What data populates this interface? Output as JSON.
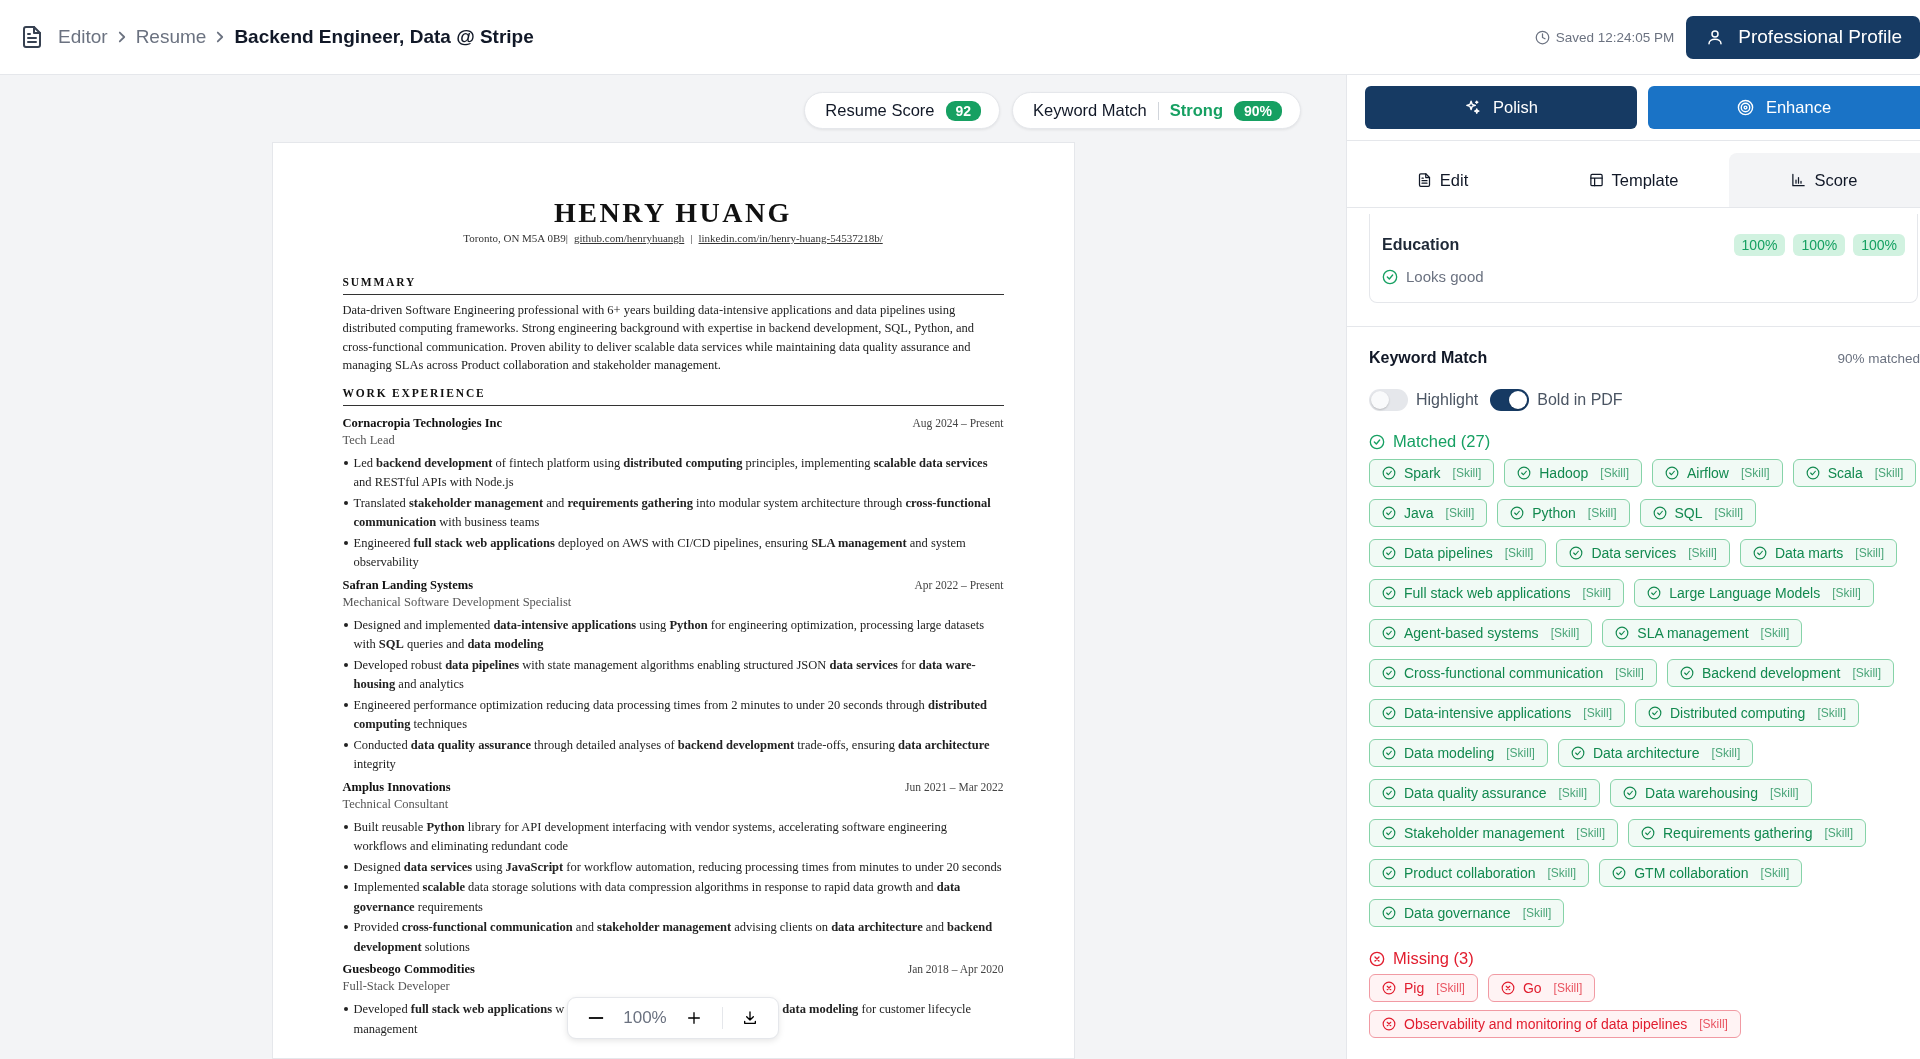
{
  "header": {
    "breadcrumb": [
      {
        "label": "Editor",
        "current": false
      },
      {
        "label": "Resume",
        "current": false
      },
      {
        "label": "Backend Engineer, Data @ Stripe",
        "current": true
      }
    ],
    "saved": "Saved 12:24:05 PM",
    "profile_button": "Professional Profile"
  },
  "scores": {
    "resume_score": {
      "label": "Resume Score",
      "value": "92"
    },
    "keyword_match": {
      "label": "Keyword Match",
      "rating": "Strong",
      "value": "90%"
    }
  },
  "resume": {
    "name": "HENRY HUANG",
    "contact": [
      {
        "kind": "text",
        "text": "Toronto, ON M5A 0B9|"
      },
      {
        "kind": "link",
        "text": "github.com/henryhuangh"
      },
      {
        "kind": "text",
        "text": "|"
      },
      {
        "kind": "link",
        "text": "linkedin.com/in/henry-huang-54537218b/"
      }
    ],
    "summary": {
      "heading": "SUMMARY",
      "text": "Data-driven Software Engineering professional with 6+ years building data-intensive applications and data pipelines using distributed computing frameworks. Strong engineering background with expertise in backend development, SQL, Python, and cross-functional communication. Proven ability to deliver scalable data services while maintaining data quality assurance and managing SLAs across Product collaboration and stakeholder management."
    },
    "experience": {
      "heading": "WORK EXPERIENCE",
      "jobs": [
        {
          "company": "Cornacropia Technologies Inc",
          "dates": "Aug 2024 – Present",
          "title": "Tech Lead",
          "bullets": [
            [
              "Led **backend development** of fintech platform using **distributed computing** principles, implementing **scalable data services** and RESTful APIs with Node.js"
            ],
            [
              "Translated **stakeholder management** and **requirements gathering** into modular system architecture through **cross-functional communication** with business teams"
            ],
            [
              "Engineered **full stack web applications** deployed on AWS with CI/CD pipelines, ensuring **SLA management** and system observability"
            ]
          ]
        },
        {
          "company": "Safran Landing Systems",
          "dates": "Apr 2022 – Present",
          "title": "Mechanical Software Development Specialist",
          "bullets": [
            [
              "Designed and implemented **data-intensive applications** using **Python** for engineering optimization, processing large datasets with **SQL** queries and **data modeling**"
            ],
            [
              "Developed robust **data pipelines** with state management algorithms enabling structured JSON **data services** for **data ware-housing** and analytics"
            ],
            [
              "Engineered performance optimization reducing data processing times from 2 minutes to under 20 seconds through **distributed computing** techniques"
            ],
            [
              "Conducted **data quality assurance** through detailed analyses of **backend development** trade-offs, ensuring **data architecture** integrity"
            ]
          ]
        },
        {
          "company": "Amplus Innovations",
          "dates": "Jun 2021 – Mar 2022",
          "title": "Technical Consultant",
          "bullets": [
            [
              "Built reusable **Python** library for API development interfacing with vendor systems, accelerating software engineering workflows and eliminating redundant code"
            ],
            [
              "Designed **data services** using **JavaScript** for workflow automation, reducing processing times from minutes to under 20 seconds"
            ],
            [
              "Implemented **scalable** data storage solutions with data compression algorithms in response to rapid data growth and **data governance** requirements"
            ],
            [
              "Provided **cross-functional communication** and **stakeholder management** advising clients on **data architecture** and **backend development** solutions"
            ]
          ]
        },
        {
          "company": "Guesbeogo Commodities",
          "dates": "Jan 2018 – Apr 2020",
          "title": "Full-Stack Developer",
          "bullets": [
            [
              "Developed **full stack web applications** w",
              "**data modeling** for customer lifecycle",
              "management"
            ]
          ]
        }
      ]
    }
  },
  "zoom_toolbar": {
    "value": "100%"
  },
  "actions": [
    {
      "label": "Polish",
      "kind": "dark"
    },
    {
      "label": "Enhance",
      "kind": "primary"
    }
  ],
  "tabs": [
    {
      "label": "Edit",
      "selected": false
    },
    {
      "label": "Template",
      "selected": false
    },
    {
      "label": "Score",
      "selected": true
    }
  ],
  "education": {
    "title": "Education",
    "status": "Looks good",
    "badges": [
      "100%",
      "100%",
      "100%"
    ]
  },
  "keyword_match": {
    "title": "Keyword Match",
    "summary": "90% matched",
    "toggles": [
      {
        "label": "Highlight",
        "on": false
      },
      {
        "label": "Bold in PDF",
        "on": true
      }
    ],
    "groups": [
      {
        "kind": "matched",
        "heading": "Matched (27)",
        "chips": [
          {
            "label": "Spark",
            "tag": "[Skill]"
          },
          {
            "label": "Hadoop",
            "tag": "[Skill]"
          },
          {
            "label": "Airflow",
            "tag": "[Skill]"
          },
          {
            "label": "Scala",
            "tag": "[Skill]"
          },
          {
            "label": "Java",
            "tag": "[Skill]"
          },
          {
            "label": "Python",
            "tag": "[Skill]"
          },
          {
            "label": "SQL",
            "tag": "[Skill]"
          },
          {
            "label": "Data pipelines",
            "tag": "[Skill]"
          },
          {
            "label": "Data services",
            "tag": "[Skill]"
          },
          {
            "label": "Data marts",
            "tag": "[Skill]"
          },
          {
            "label": "Full stack web applications",
            "tag": "[Skill]"
          },
          {
            "label": "Large Language Models",
            "tag": "[Skill]"
          },
          {
            "label": "Agent-based systems",
            "tag": "[Skill]"
          },
          {
            "label": "SLA management",
            "tag": "[Skill]"
          },
          {
            "label": "Cross-functional communication",
            "tag": "[Skill]"
          },
          {
            "label": "Backend development",
            "tag": "[Skill]"
          },
          {
            "label": "Data-intensive applications",
            "tag": "[Skill]"
          },
          {
            "label": "Distributed computing",
            "tag": "[Skill]"
          },
          {
            "label": "Data modeling",
            "tag": "[Skill]"
          },
          {
            "label": "Data architecture",
            "tag": "[Skill]"
          },
          {
            "label": "Data quality assurance",
            "tag": "[Skill]"
          },
          {
            "label": "Data warehousing",
            "tag": "[Skill]"
          },
          {
            "label": "Stakeholder management",
            "tag": "[Skill]"
          },
          {
            "label": "Requirements gathering",
            "tag": "[Skill]"
          },
          {
            "label": "Product collaboration",
            "tag": "[Skill]"
          },
          {
            "label": "GTM collaboration",
            "tag": "[Skill]"
          },
          {
            "label": "Data governance",
            "tag": "[Skill]"
          }
        ]
      },
      {
        "kind": "missing",
        "heading": "Missing (3)",
        "chips": [
          {
            "label": "Pig",
            "tag": "[Skill]"
          },
          {
            "label": "Go",
            "tag": "[Skill]"
          },
          {
            "label": "Observability and monitoring of data pipelines",
            "tag": "[Skill]"
          }
        ]
      }
    ]
  }
}
